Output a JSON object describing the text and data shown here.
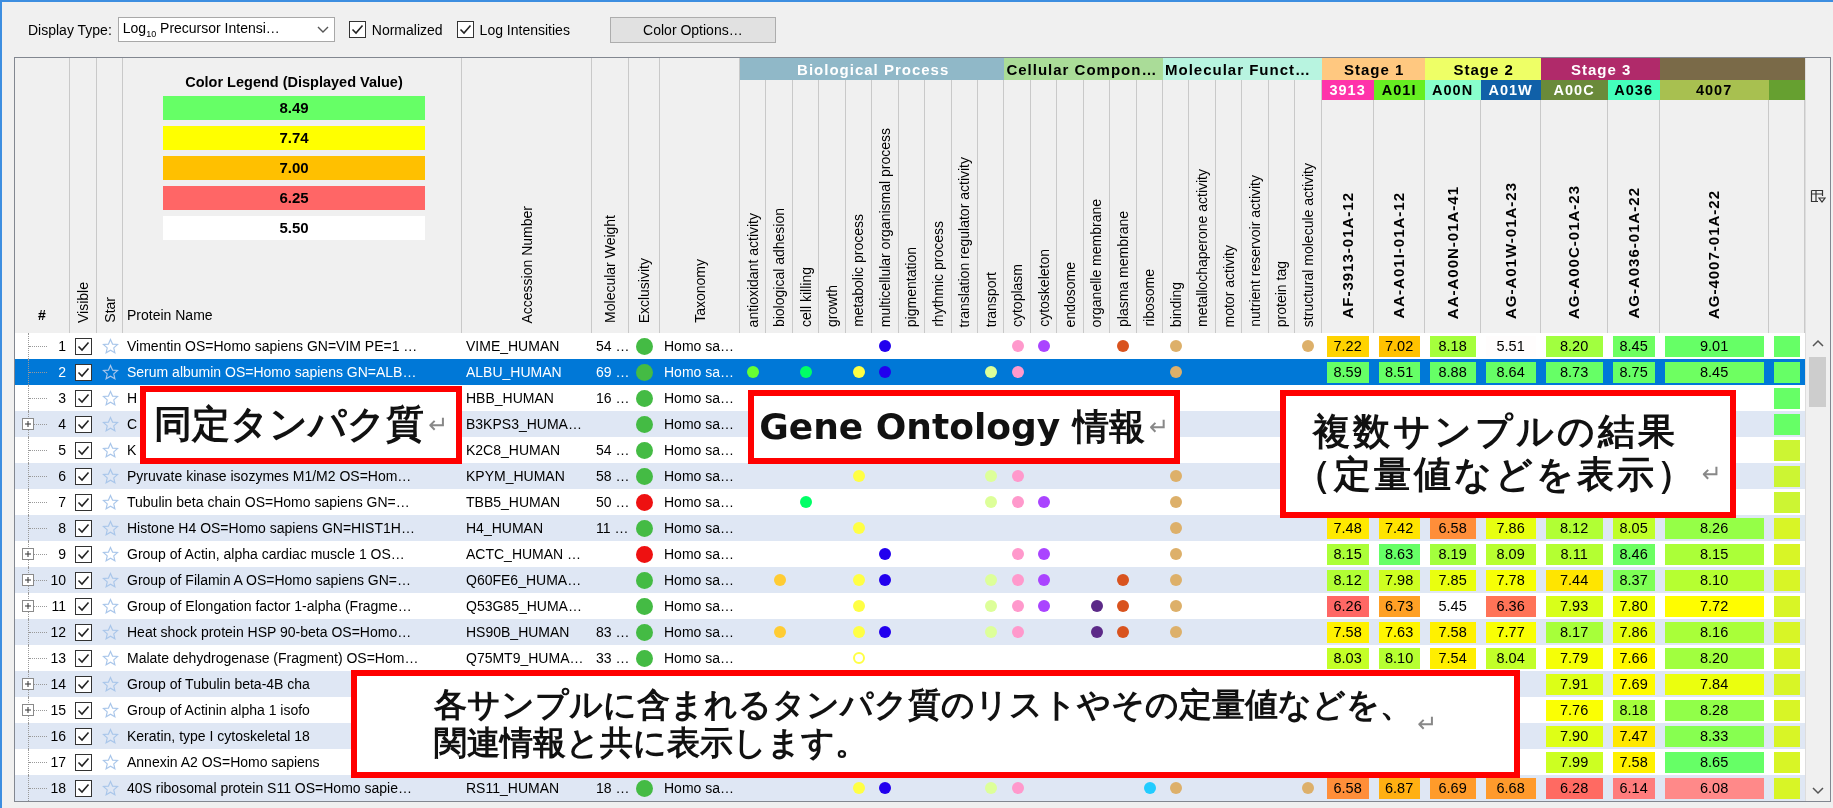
{
  "toolbar": {
    "display_type_label": "Display Type:",
    "display_type": "Log$_{10}$ Precursor Intensi…",
    "checkboxes": [
      {
        "label": "Normalized",
        "checked": true
      },
      {
        "label": "Log Intensities",
        "checked": true
      }
    ],
    "button": "Color Options…"
  },
  "legend": {
    "title": "Color Legend (Displayed Value)",
    "items": [
      {
        "value": "8.49",
        "color": "#66ff66"
      },
      {
        "value": "7.74",
        "color": "#ffff00"
      },
      {
        "value": "7.00",
        "color": "#ffc000"
      },
      {
        "value": "6.25",
        "color": "#ff6666"
      },
      {
        "value": "5.50",
        "color": "#ffffff"
      }
    ]
  },
  "columns": {
    "number": "#",
    "visible": "Visible",
    "star": "Star",
    "protein": "Protein Name",
    "accession": "Accession Number",
    "weight": "Molecular Weight",
    "exclusivity": "Exclusivity",
    "taxonomy": "Taxonomy"
  },
  "go_groups": [
    {
      "label": "Biological Process",
      "color": "#90b8c8",
      "terms": [
        {
          "label": "antioxidant activity",
          "color": "#66ff33"
        },
        {
          "label": "biological adhesion",
          "color": "#ffcc33"
        },
        {
          "label": "cell killing",
          "color": "#00ff66"
        },
        {
          "label": "growth"
        },
        {
          "label": "metabolic process",
          "color": "#ffff44"
        },
        {
          "label": "multicellular organismal process",
          "color": "#2200ee"
        },
        {
          "label": "pigmentation"
        },
        {
          "label": "rhythmic process"
        },
        {
          "label": "translation regulator activity"
        },
        {
          "label": "transport",
          "color": "#ddff99"
        }
      ]
    },
    {
      "label": "Cellular Compon…",
      "color": "#aadc98",
      "terms": [
        {
          "label": "cytoplasm",
          "color": "#ff99cc"
        },
        {
          "label": "cytoskeleton",
          "color": "#aa44ff"
        },
        {
          "label": "endosome"
        },
        {
          "label": "organelle membrane",
          "color": "#5c2a88"
        },
        {
          "label": "plasma membrane",
          "color": "#d9531e"
        },
        {
          "label": "ribosome",
          "color": "#22ccff"
        }
      ]
    },
    {
      "label": "Molecular Funct…",
      "color": "#b8f4e0",
      "terms": [
        {
          "label": "binding",
          "color": "#ddb06a"
        },
        {
          "label": "metallochaperone activity"
        },
        {
          "label": "motor activity"
        },
        {
          "label": "nutrient reservoir activity"
        },
        {
          "label": "protein tag"
        },
        {
          "label": "structural molecule activity",
          "color": "#ddb06a"
        }
      ]
    }
  ],
  "stages": [
    {
      "label": "Stage 1",
      "color": "#ffc880",
      "samples": [
        {
          "short": "3913",
          "color": "#ff33aa",
          "name": "AF-3913-01A-12"
        },
        {
          "short": "A01I",
          "color": "#66ee22",
          "name": "AA-A01I-01A-12"
        }
      ]
    },
    {
      "label": "Stage 2",
      "color": "#eeff66",
      "samples": [
        {
          "short": "A00N",
          "color": "#88ffcc",
          "name": "AA-A00N-01A-41"
        },
        {
          "short": "A01W",
          "color": "#1060a8",
          "name": "AG-A01W-01A-23"
        }
      ]
    },
    {
      "label": "Stage 3",
      "color": "#b02a6a",
      "samples": [
        {
          "short": "A00C",
          "color": "#6a8a3a",
          "name": "AG-A00C-01A-23"
        },
        {
          "short": "A036",
          "color": "#44ffbb",
          "name": "AG-A036-01A-22"
        }
      ]
    },
    {
      "color": "#7a6a48",
      "samples": [
        {
          "short": "4007",
          "color": "#a8c050",
          "name": "AG-4007-01A-22"
        },
        {
          "color": "#66a030"
        }
      ]
    }
  ],
  "rows": [
    {
      "number": "1",
      "expandable": false,
      "visible": true,
      "starred": false,
      "selected": false,
      "protein": "Vimentin OS=Homo sapiens GN=VIM PE=1 …",
      "accession": "VIME_HUMAN",
      "weight": "54 …",
      "exclusivity": {
        "color": "#44bb44"
      },
      "taxonomy": "Homo sa…",
      "go": [
        {
          "kind": "empty"
        },
        {
          "kind": "empty"
        },
        {
          "kind": "empty"
        },
        {
          "kind": "empty"
        },
        {
          "kind": "empty"
        },
        {
          "kind": "dot"
        },
        {
          "kind": "empty"
        },
        {
          "kind": "empty"
        },
        {
          "kind": "empty"
        },
        {
          "kind": "empty"
        },
        {
          "kind": "dot"
        },
        {
          "kind": "dot"
        },
        {
          "kind": "empty"
        },
        {
          "kind": "empty"
        },
        {
          "kind": "dot"
        },
        {
          "kind": "empty"
        },
        {
          "kind": "dot"
        },
        {
          "kind": "empty"
        },
        {
          "kind": "empty"
        },
        {
          "kind": "empty"
        },
        {
          "kind": "empty"
        },
        {
          "kind": "dot"
        }
      ],
      "samples": [
        {
          "kind": "value",
          "value": "7.22"
        },
        {
          "kind": "value",
          "value": "7.02"
        },
        {
          "kind": "value",
          "value": "8.18"
        },
        {
          "kind": "value",
          "value": "5.51"
        },
        {
          "kind": "value",
          "value": "8.20"
        },
        {
          "kind": "value",
          "value": "8.45"
        },
        {
          "kind": "value",
          "value": "9.01"
        },
        {
          "kind": "fill",
          "color": "#66ff66"
        }
      ]
    },
    {
      "number": "2",
      "expandable": false,
      "visible": true,
      "starred": false,
      "selected": true,
      "protein": "Serum albumin OS=Homo sapiens GN=ALB…",
      "accession": "ALBU_HUMAN",
      "weight": "69 …",
      "exclusivity": {
        "color": "#44bb44"
      },
      "taxonomy": "Homo sa…",
      "go": [
        {
          "kind": "dot"
        },
        {
          "kind": "empty"
        },
        {
          "kind": "dot"
        },
        {
          "kind": "empty"
        },
        {
          "kind": "dot"
        },
        {
          "kind": "dot"
        },
        {
          "kind": "empty"
        },
        {
          "kind": "empty"
        },
        {
          "kind": "empty"
        },
        {
          "kind": "dot"
        },
        {
          "kind": "dot"
        },
        {
          "kind": "empty"
        },
        {
          "kind": "empty"
        },
        {
          "kind": "empty"
        },
        {
          "kind": "empty"
        },
        {
          "kind": "empty"
        },
        {
          "kind": "dot"
        },
        {
          "kind": "empty"
        },
        {
          "kind": "empty"
        },
        {
          "kind": "empty"
        },
        {
          "kind": "empty"
        },
        {
          "kind": "empty"
        }
      ],
      "samples": [
        {
          "kind": "value",
          "value": "8.59"
        },
        {
          "kind": "value",
          "value": "8.51"
        },
        {
          "kind": "value",
          "value": "8.88"
        },
        {
          "kind": "value",
          "value": "8.64"
        },
        {
          "kind": "value",
          "value": "8.73"
        },
        {
          "kind": "value",
          "value": "8.75"
        },
        {
          "kind": "value",
          "value": "8.45"
        },
        {
          "kind": "fill",
          "color": "#66ff66"
        }
      ]
    },
    {
      "number": "3",
      "expandable": false,
      "visible": true,
      "starred": false,
      "selected": false,
      "protein": "H",
      "accession": "HBB_HUMAN",
      "weight": "16 …",
      "exclusivity": {
        "color": "#44bb44"
      },
      "taxonomy": "Homo sa…",
      "samples": [
        {
          "kind": "covered"
        },
        {
          "kind": "covered"
        },
        {
          "kind": "covered"
        },
        {
          "kind": "covered"
        },
        {
          "kind": "covered"
        },
        {
          "kind": "covered"
        },
        {
          "kind": "covered"
        },
        {
          "kind": "fill",
          "color": "#66ff66"
        }
      ]
    },
    {
      "number": "4",
      "expandable": true,
      "visible": true,
      "starred": false,
      "selected": false,
      "protein": "C",
      "accession": "B3KPS3_HUMA…",
      "exclusivity": {
        "color": "#44bb44"
      },
      "taxonomy": "Homo sa…",
      "samples": [
        {
          "kind": "covered"
        },
        {
          "kind": "covered"
        },
        {
          "kind": "covered"
        },
        {
          "kind": "covered"
        },
        {
          "kind": "covered"
        },
        {
          "kind": "covered"
        },
        {
          "kind": "covered"
        },
        {
          "kind": "fill",
          "color": "#66ff66"
        }
      ]
    },
    {
      "number": "5",
      "expandable": false,
      "visible": true,
      "starred": false,
      "selected": false,
      "protein": "K",
      "accession": "K2C8_HUMAN",
      "weight": "54 …",
      "exclusivity": {
        "color": "#44bb44"
      },
      "taxonomy": "Homo sa…",
      "samples": [
        {
          "kind": "covered"
        },
        {
          "kind": "covered"
        },
        {
          "kind": "covered"
        },
        {
          "kind": "covered"
        },
        {
          "kind": "covered"
        },
        {
          "kind": "covered"
        },
        {
          "kind": "covered"
        },
        {
          "kind": "fill",
          "color": "#ccf533"
        }
      ]
    },
    {
      "number": "6",
      "expandable": false,
      "visible": true,
      "starred": false,
      "selected": false,
      "protein": "Pyruvate kinase isozymes M1/M2 OS=Hom…",
      "accession": "KPYM_HUMAN",
      "weight": "58 …",
      "exclusivity": {
        "color": "#44bb44"
      },
      "taxonomy": "Homo sa…",
      "go": [
        {
          "kind": "empty"
        },
        {
          "kind": "empty"
        },
        {
          "kind": "empty"
        },
        {
          "kind": "empty"
        },
        {
          "kind": "dot"
        },
        {
          "kind": "empty"
        },
        {
          "kind": "empty"
        },
        {
          "kind": "empty"
        },
        {
          "kind": "empty"
        },
        {
          "kind": "dot"
        },
        {
          "kind": "dot"
        },
        {
          "kind": "empty"
        },
        {
          "kind": "empty"
        },
        {
          "kind": "empty"
        },
        {
          "kind": "empty"
        },
        {
          "kind": "empty"
        },
        {
          "kind": "dot"
        },
        {
          "kind": "empty"
        },
        {
          "kind": "empty"
        },
        {
          "kind": "empty"
        },
        {
          "kind": "empty"
        },
        {
          "kind": "empty"
        }
      ],
      "samples": [
        {
          "kind": "covered"
        },
        {
          "kind": "covered"
        },
        {
          "kind": "covered"
        },
        {
          "kind": "covered"
        },
        {
          "kind": "covered"
        },
        {
          "kind": "covered"
        },
        {
          "kind": "covered"
        },
        {
          "kind": "fill",
          "color": "#ccf533"
        }
      ]
    },
    {
      "number": "7",
      "expandable": false,
      "visible": true,
      "starred": false,
      "selected": false,
      "protein": "Tubulin beta chain OS=Homo sapiens GN=…",
      "accession": "TBB5_HUMAN",
      "weight": "50 …",
      "exclusivity": {
        "color": "#ee1111"
      },
      "taxonomy": "Homo sa…",
      "go": [
        {
          "kind": "empty"
        },
        {
          "kind": "empty"
        },
        {
          "kind": "dot"
        },
        {
          "kind": "empty"
        },
        {
          "kind": "empty"
        },
        {
          "kind": "empty"
        },
        {
          "kind": "empty"
        },
        {
          "kind": "empty"
        },
        {
          "kind": "empty"
        },
        {
          "kind": "dot"
        },
        {
          "kind": "dot"
        },
        {
          "kind": "dot"
        },
        {
          "kind": "empty"
        },
        {
          "kind": "empty"
        },
        {
          "kind": "empty"
        },
        {
          "kind": "empty"
        },
        {
          "kind": "dot"
        },
        {
          "kind": "empty"
        },
        {
          "kind": "empty"
        },
        {
          "kind": "empty"
        },
        {
          "kind": "empty"
        },
        {
          "kind": "empty"
        }
      ],
      "samples": [
        {
          "kind": "covered"
        },
        {
          "kind": "covered"
        },
        {
          "kind": "covered"
        },
        {
          "kind": "covered"
        },
        {
          "kind": "covered"
        },
        {
          "kind": "covered"
        },
        {
          "kind": "covered"
        },
        {
          "kind": "fill",
          "color": "#ccf533"
        }
      ]
    },
    {
      "number": "8",
      "expandable": false,
      "visible": true,
      "starred": false,
      "selected": false,
      "protein": "Histone H4 OS=Homo sapiens GN=HIST1H…",
      "accession": "H4_HUMAN",
      "weight": "11 …",
      "exclusivity": {
        "color": "#44bb44"
      },
      "taxonomy": "Homo sa…",
      "go": [
        {
          "kind": "empty"
        },
        {
          "kind": "empty"
        },
        {
          "kind": "empty"
        },
        {
          "kind": "empty"
        },
        {
          "kind": "dot"
        },
        {
          "kind": "empty"
        },
        {
          "kind": "empty"
        },
        {
          "kind": "empty"
        },
        {
          "kind": "empty"
        },
        {
          "kind": "empty"
        },
        {
          "kind": "empty"
        },
        {
          "kind": "empty"
        },
        {
          "kind": "empty"
        },
        {
          "kind": "empty"
        },
        {
          "kind": "empty"
        },
        {
          "kind": "empty"
        },
        {
          "kind": "dot"
        },
        {
          "kind": "empty"
        },
        {
          "kind": "empty"
        },
        {
          "kind": "empty"
        },
        {
          "kind": "empty"
        },
        {
          "kind": "empty"
        }
      ],
      "samples": [
        {
          "kind": "value",
          "value": "7.48"
        },
        {
          "kind": "value",
          "value": "7.42"
        },
        {
          "kind": "value",
          "value": "6.58"
        },
        {
          "kind": "value",
          "value": "7.86"
        },
        {
          "kind": "value",
          "value": "8.12"
        },
        {
          "kind": "value",
          "value": "8.05"
        },
        {
          "kind": "value",
          "value": "8.26"
        },
        {
          "kind": "fill",
          "color": "#d8f526"
        }
      ]
    },
    {
      "number": "9",
      "expandable": true,
      "visible": true,
      "starred": false,
      "selected": false,
      "protein": "Group of Actin, alpha cardiac muscle 1 OS…",
      "accession": "ACTC_HUMAN …",
      "exclusivity": {
        "color": "#ee1111"
      },
      "taxonomy": "Homo sa…",
      "go": [
        {
          "kind": "empty"
        },
        {
          "kind": "empty"
        },
        {
          "kind": "empty"
        },
        {
          "kind": "empty"
        },
        {
          "kind": "empty"
        },
        {
          "kind": "dot"
        },
        {
          "kind": "empty"
        },
        {
          "kind": "empty"
        },
        {
          "kind": "empty"
        },
        {
          "kind": "empty"
        },
        {
          "kind": "dot"
        },
        {
          "kind": "dot"
        },
        {
          "kind": "empty"
        },
        {
          "kind": "empty"
        },
        {
          "kind": "empty"
        },
        {
          "kind": "empty"
        },
        {
          "kind": "dot"
        },
        {
          "kind": "empty"
        },
        {
          "kind": "empty"
        },
        {
          "kind": "empty"
        },
        {
          "kind": "empty"
        },
        {
          "kind": "empty"
        }
      ],
      "samples": [
        {
          "kind": "value",
          "value": "8.15"
        },
        {
          "kind": "value",
          "value": "8.63"
        },
        {
          "kind": "value",
          "value": "8.19"
        },
        {
          "kind": "value",
          "value": "8.09"
        },
        {
          "kind": "value",
          "value": "8.11"
        },
        {
          "kind": "value",
          "value": "8.46"
        },
        {
          "kind": "value",
          "value": "8.15"
        },
        {
          "kind": "fill",
          "color": "#d8f526"
        }
      ]
    },
    {
      "number": "10",
      "expandable": true,
      "visible": true,
      "starred": false,
      "selected": false,
      "protein": "Group of Filamin A OS=Homo sapiens GN=…",
      "accession": "Q60FE6_HUMA…",
      "exclusivity": {
        "color": "#44bb44"
      },
      "taxonomy": "Homo sa…",
      "go": [
        {
          "kind": "empty"
        },
        {
          "kind": "dot"
        },
        {
          "kind": "empty"
        },
        {
          "kind": "empty"
        },
        {
          "kind": "dot"
        },
        {
          "kind": "dot"
        },
        {
          "kind": "empty"
        },
        {
          "kind": "empty"
        },
        {
          "kind": "empty"
        },
        {
          "kind": "dot"
        },
        {
          "kind": "dot"
        },
        {
          "kind": "dot"
        },
        {
          "kind": "empty"
        },
        {
          "kind": "empty"
        },
        {
          "kind": "dot"
        },
        {
          "kind": "empty"
        },
        {
          "kind": "dot"
        },
        {
          "kind": "empty"
        },
        {
          "kind": "empty"
        },
        {
          "kind": "empty"
        },
        {
          "kind": "empty"
        },
        {
          "kind": "empty"
        }
      ],
      "samples": [
        {
          "kind": "value",
          "value": "8.12"
        },
        {
          "kind": "value",
          "value": "7.98"
        },
        {
          "kind": "value",
          "value": "7.85"
        },
        {
          "kind": "value",
          "value": "7.78"
        },
        {
          "kind": "value",
          "value": "7.44"
        },
        {
          "kind": "value",
          "value": "8.37"
        },
        {
          "kind": "value",
          "value": "8.10"
        },
        {
          "kind": "fill",
          "color": "#d8f526"
        }
      ]
    },
    {
      "number": "11",
      "expandable": true,
      "visible": true,
      "starred": false,
      "selected": false,
      "protein": "Group of Elongation factor 1-alpha (Fragme…",
      "accession": "Q53G85_HUMA…",
      "exclusivity": {
        "color": "#44bb44"
      },
      "taxonomy": "Homo sa…",
      "go": [
        {
          "kind": "empty"
        },
        {
          "kind": "empty"
        },
        {
          "kind": "empty"
        },
        {
          "kind": "empty"
        },
        {
          "kind": "dot"
        },
        {
          "kind": "empty"
        },
        {
          "kind": "empty"
        },
        {
          "kind": "empty"
        },
        {
          "kind": "empty"
        },
        {
          "kind": "dot"
        },
        {
          "kind": "dot"
        },
        {
          "kind": "dot"
        },
        {
          "kind": "empty"
        },
        {
          "kind": "dot"
        },
        {
          "kind": "dot"
        },
        {
          "kind": "empty"
        },
        {
          "kind": "dot"
        },
        {
          "kind": "empty"
        },
        {
          "kind": "empty"
        },
        {
          "kind": "empty"
        },
        {
          "kind": "empty"
        },
        {
          "kind": "empty"
        }
      ],
      "samples": [
        {
          "kind": "value",
          "value": "6.26"
        },
        {
          "kind": "value",
          "value": "6.73"
        },
        {
          "kind": "value",
          "value": "5.45"
        },
        {
          "kind": "value",
          "value": "6.36"
        },
        {
          "kind": "value",
          "value": "7.93"
        },
        {
          "kind": "value",
          "value": "7.80"
        },
        {
          "kind": "value",
          "value": "7.72"
        },
        {
          "kind": "fill",
          "color": "#d8f526"
        }
      ]
    },
    {
      "number": "12",
      "expandable": false,
      "visible": true,
      "starred": false,
      "selected": false,
      "protein": "Heat shock protein HSP 90-beta OS=Homo…",
      "accession": "HS90B_HUMAN",
      "weight": "83 …",
      "exclusivity": {
        "color": "#44bb44"
      },
      "taxonomy": "Homo sa…",
      "go": [
        {
          "kind": "empty"
        },
        {
          "kind": "dot"
        },
        {
          "kind": "empty"
        },
        {
          "kind": "empty"
        },
        {
          "kind": "dot"
        },
        {
          "kind": "dot"
        },
        {
          "kind": "empty"
        },
        {
          "kind": "empty"
        },
        {
          "kind": "empty"
        },
        {
          "kind": "dot"
        },
        {
          "kind": "dot"
        },
        {
          "kind": "empty"
        },
        {
          "kind": "empty"
        },
        {
          "kind": "dot"
        },
        {
          "kind": "dot"
        },
        {
          "kind": "empty"
        },
        {
          "kind": "dot"
        },
        {
          "kind": "empty"
        },
        {
          "kind": "empty"
        },
        {
          "kind": "empty"
        },
        {
          "kind": "empty"
        },
        {
          "kind": "empty"
        }
      ],
      "samples": [
        {
          "kind": "value",
          "value": "7.58"
        },
        {
          "kind": "value",
          "value": "7.63"
        },
        {
          "kind": "value",
          "value": "7.58"
        },
        {
          "kind": "value",
          "value": "7.77"
        },
        {
          "kind": "value",
          "value": "8.17"
        },
        {
          "kind": "value",
          "value": "7.86"
        },
        {
          "kind": "value",
          "value": "8.16"
        },
        {
          "kind": "fill",
          "color": "#d8f526"
        }
      ]
    },
    {
      "number": "13",
      "expandable": false,
      "visible": true,
      "starred": false,
      "selected": false,
      "protein": "Malate dehydrogenase (Fragment) OS=Hom…",
      "accession": "Q75MT9_HUMA…",
      "weight": "33 …",
      "exclusivity": {
        "color": "#44bb44"
      },
      "taxonomy": "Homo sa…",
      "go": [
        {
          "kind": "empty"
        },
        {
          "kind": "empty"
        },
        {
          "kind": "empty"
        },
        {
          "kind": "empty"
        },
        {
          "kind": "ring"
        },
        {
          "kind": "empty"
        },
        {
          "kind": "empty"
        },
        {
          "kind": "empty"
        },
        {
          "kind": "empty"
        },
        {
          "kind": "empty"
        },
        {
          "kind": "empty"
        },
        {
          "kind": "empty"
        },
        {
          "kind": "empty"
        },
        {
          "kind": "empty"
        },
        {
          "kind": "empty"
        },
        {
          "kind": "empty"
        },
        {
          "kind": "empty"
        },
        {
          "kind": "empty"
        },
        {
          "kind": "empty"
        },
        {
          "kind": "empty"
        },
        {
          "kind": "empty"
        },
        {
          "kind": "empty"
        }
      ],
      "samples": [
        {
          "kind": "value",
          "value": "8.03"
        },
        {
          "kind": "value",
          "value": "8.10"
        },
        {
          "kind": "value",
          "value": "7.54"
        },
        {
          "kind": "value",
          "value": "8.04"
        },
        {
          "kind": "value",
          "value": "7.79"
        },
        {
          "kind": "value",
          "value": "7.66"
        },
        {
          "kind": "value",
          "value": "8.20"
        },
        {
          "kind": "fill",
          "color": "#d8f526"
        }
      ]
    },
    {
      "number": "14",
      "expandable": true,
      "visible": true,
      "starred": false,
      "selected": false,
      "protein": "Group of Tubulin beta-4B cha",
      "samples": [
        {
          "kind": "covered"
        },
        {
          "kind": "covered"
        },
        {
          "kind": "covered"
        },
        {
          "kind": "covered"
        },
        {
          "kind": "value",
          "value": "7.91"
        },
        {
          "kind": "value",
          "value": "7.69"
        },
        {
          "kind": "value",
          "value": "7.84"
        },
        {
          "kind": "fill",
          "color": "#d8f526"
        }
      ]
    },
    {
      "number": "15",
      "expandable": true,
      "visible": true,
      "starred": false,
      "selected": false,
      "protein": "Group of Actinin alpha 1 isofo",
      "samples": [
        {
          "kind": "covered"
        },
        {
          "kind": "covered"
        },
        {
          "kind": "covered"
        },
        {
          "kind": "covered"
        },
        {
          "kind": "value",
          "value": "7.76"
        },
        {
          "kind": "value",
          "value": "8.18"
        },
        {
          "kind": "value",
          "value": "8.28"
        },
        {
          "kind": "fill",
          "color": "#d8f526"
        }
      ]
    },
    {
      "number": "16",
      "expandable": false,
      "visible": true,
      "starred": false,
      "selected": false,
      "protein": "Keratin, type I cytoskeletal 18",
      "samples": [
        {
          "kind": "covered"
        },
        {
          "kind": "covered"
        },
        {
          "kind": "covered"
        },
        {
          "kind": "covered"
        },
        {
          "kind": "value",
          "value": "7.90"
        },
        {
          "kind": "value",
          "value": "7.47"
        },
        {
          "kind": "value",
          "value": "8.33"
        },
        {
          "kind": "fill",
          "color": "#d8f526"
        }
      ]
    },
    {
      "number": "17",
      "expandable": false,
      "visible": true,
      "starred": false,
      "selected": false,
      "protein": "Annexin A2 OS=Homo sapiens",
      "samples": [
        {
          "kind": "covered"
        },
        {
          "kind": "covered"
        },
        {
          "kind": "covered"
        },
        {
          "kind": "covered"
        },
        {
          "kind": "value",
          "value": "7.99"
        },
        {
          "kind": "value",
          "value": "7.58"
        },
        {
          "kind": "value",
          "value": "8.65"
        },
        {
          "kind": "fill",
          "color": "#d8f526"
        }
      ]
    },
    {
      "number": "18",
      "expandable": false,
      "visible": true,
      "starred": false,
      "selected": false,
      "protein": "40S ribosomal protein S11 OS=Homo sapie…",
      "accession": "RS11_HUMAN",
      "weight": "18 …",
      "exclusivity": {
        "color": "#44bb44"
      },
      "taxonomy": "Homo sa…",
      "go": [
        {
          "kind": "empty"
        },
        {
          "kind": "empty"
        },
        {
          "kind": "empty"
        },
        {
          "kind": "empty"
        },
        {
          "kind": "dot"
        },
        {
          "kind": "dot"
        },
        {
          "kind": "empty"
        },
        {
          "kind": "empty"
        },
        {
          "kind": "empty"
        },
        {
          "kind": "dot"
        },
        {
          "kind": "dot"
        },
        {
          "kind": "empty"
        },
        {
          "kind": "empty"
        },
        {
          "kind": "empty"
        },
        {
          "kind": "empty"
        },
        {
          "kind": "dot"
        },
        {
          "kind": "dot"
        },
        {
          "kind": "empty"
        },
        {
          "kind": "empty"
        },
        {
          "kind": "empty"
        },
        {
          "kind": "empty"
        },
        {
          "kind": "dot"
        }
      ],
      "samples": [
        {
          "kind": "value",
          "value": "6.58"
        },
        {
          "kind": "value",
          "value": "6.87"
        },
        {
          "kind": "value",
          "value": "6.69"
        },
        {
          "kind": "value",
          "value": "6.68"
        },
        {
          "kind": "value",
          "value": "6.28"
        },
        {
          "kind": "value",
          "value": "6.14"
        },
        {
          "kind": "value",
          "value": "6.08"
        },
        {
          "kind": "fill",
          "color": "#d8f526"
        }
      ]
    }
  ],
  "callouts": [
    {
      "lines": [
        "同定タンパク質"
      ],
      "mark": "↵"
    },
    {
      "lines": [
        "Gene Ontology 情報"
      ],
      "mark": "↵"
    },
    {
      "lines": [
        "複数サンプルの結果",
        "（定量値などを表示）"
      ],
      "mark": "↵"
    },
    {
      "lines": [
        "各サンプルに含まれるタンパク質のリストやその定量値などを、",
        "関連情報と共に表示します。"
      ],
      "mark": "↵"
    }
  ]
}
